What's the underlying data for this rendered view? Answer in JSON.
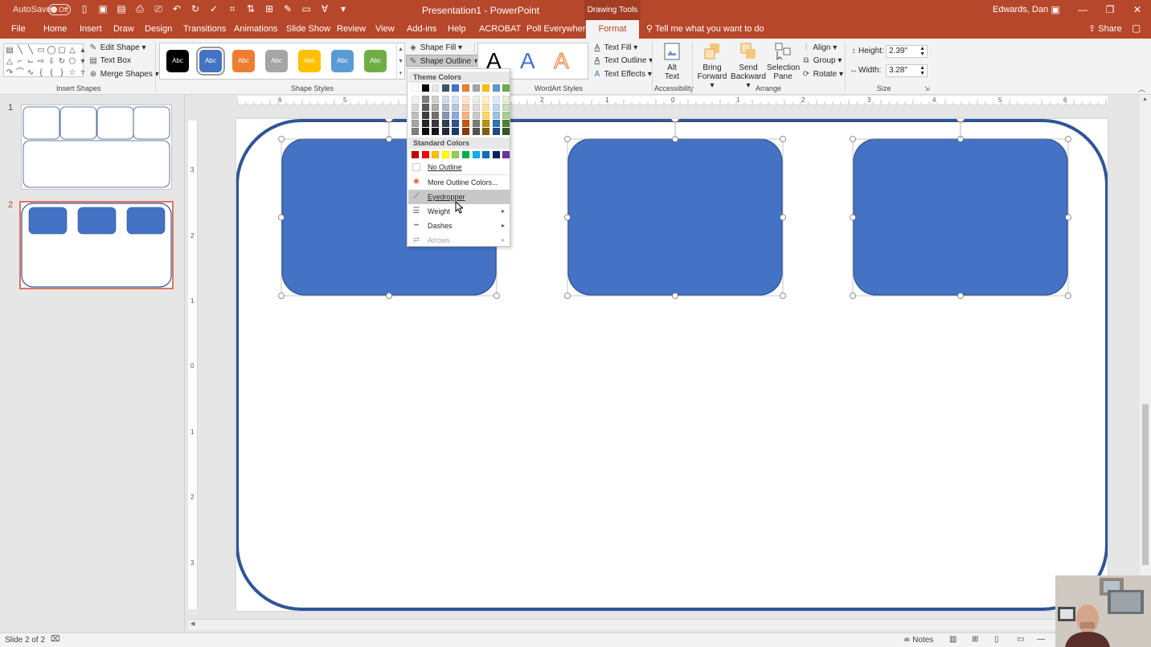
{
  "window": {
    "autosave": "AutoSave",
    "autosave_state": "Off",
    "title": "Presentation1  -  PowerPoint",
    "contextual_tools": "Drawing Tools",
    "user": "Edwards, Dan"
  },
  "tabs": [
    "File",
    "Home",
    "Insert",
    "Draw",
    "Design",
    "Transitions",
    "Animations",
    "Slide Show",
    "Review",
    "View",
    "Add-ins",
    "Help",
    "ACROBAT",
    "Poll Everywhere",
    "Format"
  ],
  "active_tab": "Format",
  "tell_me": "Tell me what you want to do",
  "share": "Share",
  "ribbon": {
    "insert_shapes": {
      "label": "Insert Shapes",
      "edit_shape": "Edit Shape",
      "text_box": "Text Box",
      "merge_shapes": "Merge Shapes"
    },
    "shape_styles": {
      "label": "Shape Styles",
      "swatch_text": "Abc",
      "swatches": [
        "#000000",
        "#4472c4",
        "#ed7d31",
        "#a5a5a5",
        "#ffc000",
        "#5b9bd5",
        "#70ad47"
      ],
      "shape_fill": "Shape Fill",
      "shape_outline": "Shape Outline"
    },
    "wordart": {
      "label": "WordArt Styles",
      "letter": "A",
      "text_fill": "Text Fill",
      "text_outline": "Text Outline",
      "text_effects": "Text Effects"
    },
    "accessibility": {
      "label": "Accessibility",
      "alt_text_1": "Alt",
      "alt_text_2": "Text"
    },
    "arrange": {
      "label": "Arrange",
      "bring_forward_1": "Bring",
      "bring_forward_2": "Forward",
      "send_backward_1": "Send",
      "send_backward_2": "Backward",
      "selection_pane_1": "Selection",
      "selection_pane_2": "Pane",
      "align": "Align",
      "group": "Group",
      "rotate": "Rotate"
    },
    "size": {
      "label": "Size",
      "height_label": "Height:",
      "height_value": "2.39\"",
      "width_label": "Width:",
      "width_value": "3.28\""
    }
  },
  "outline_menu": {
    "theme_colors_header": "Theme Colors",
    "theme_top_row": [
      "#ffffff",
      "#000000",
      "#e7e6e6",
      "#44546a",
      "#4472c4",
      "#ed7d31",
      "#a5a5a5",
      "#ffc000",
      "#5b9bd5",
      "#70ad47"
    ],
    "theme_tints": [
      [
        "#f2f2f2",
        "#7f7f7f",
        "#d0cece",
        "#d6dce4",
        "#d9e2f3",
        "#fbe5d5",
        "#ededed",
        "#fff2cc",
        "#deeaf6",
        "#e2efd9"
      ],
      [
        "#d8d8d8",
        "#595959",
        "#aeabab",
        "#adb9ca",
        "#b4c6e7",
        "#f7cbac",
        "#dbdbdb",
        "#fee599",
        "#bdd7ee",
        "#c5e0b3"
      ],
      [
        "#bfbfbf",
        "#3f3f3f",
        "#757070",
        "#8496b0",
        "#8eaadb",
        "#f4b183",
        "#c9c9c9",
        "#ffd965",
        "#9cc3e5",
        "#a8d08d"
      ],
      [
        "#a5a5a5",
        "#262626",
        "#3a3838",
        "#333f4f",
        "#2f5496",
        "#c55a11",
        "#7b7b7b",
        "#bf9000",
        "#2e75b5",
        "#538135"
      ],
      [
        "#7f7f7f",
        "#0c0c0c",
        "#171616",
        "#222a35",
        "#1f3864",
        "#833c0b",
        "#525252",
        "#7f6000",
        "#1e4e79",
        "#375623"
      ]
    ],
    "standard_colors_header": "Standard Colors",
    "standard_colors": [
      "#c00000",
      "#ff0000",
      "#ffc000",
      "#ffff00",
      "#92d050",
      "#00b050",
      "#00b0f0",
      "#0070c0",
      "#002060",
      "#7030a0"
    ],
    "no_outline": "No Outline",
    "more_colors": "More Outline Colors...",
    "eyedropper": "Eyedropper",
    "weight": "Weight",
    "dashes": "Dashes",
    "arrows": "Arrows"
  },
  "slides": {
    "numbers": [
      "1",
      "2"
    ],
    "active": "2"
  },
  "rulers": {
    "horizontal": [
      "6",
      "5",
      "2",
      "1",
      "0",
      "1",
      "2",
      "3",
      "4",
      "5",
      "6"
    ],
    "vertical": [
      "3",
      "2",
      "1",
      "0",
      "1",
      "2",
      "3"
    ]
  },
  "canvas": {
    "shape_fill": "#4472c4",
    "shape_stroke": "#2f528f",
    "frame_stroke": "#2f5597"
  },
  "status": {
    "slide_info": "Slide 2 of 2",
    "notes": "Notes"
  }
}
